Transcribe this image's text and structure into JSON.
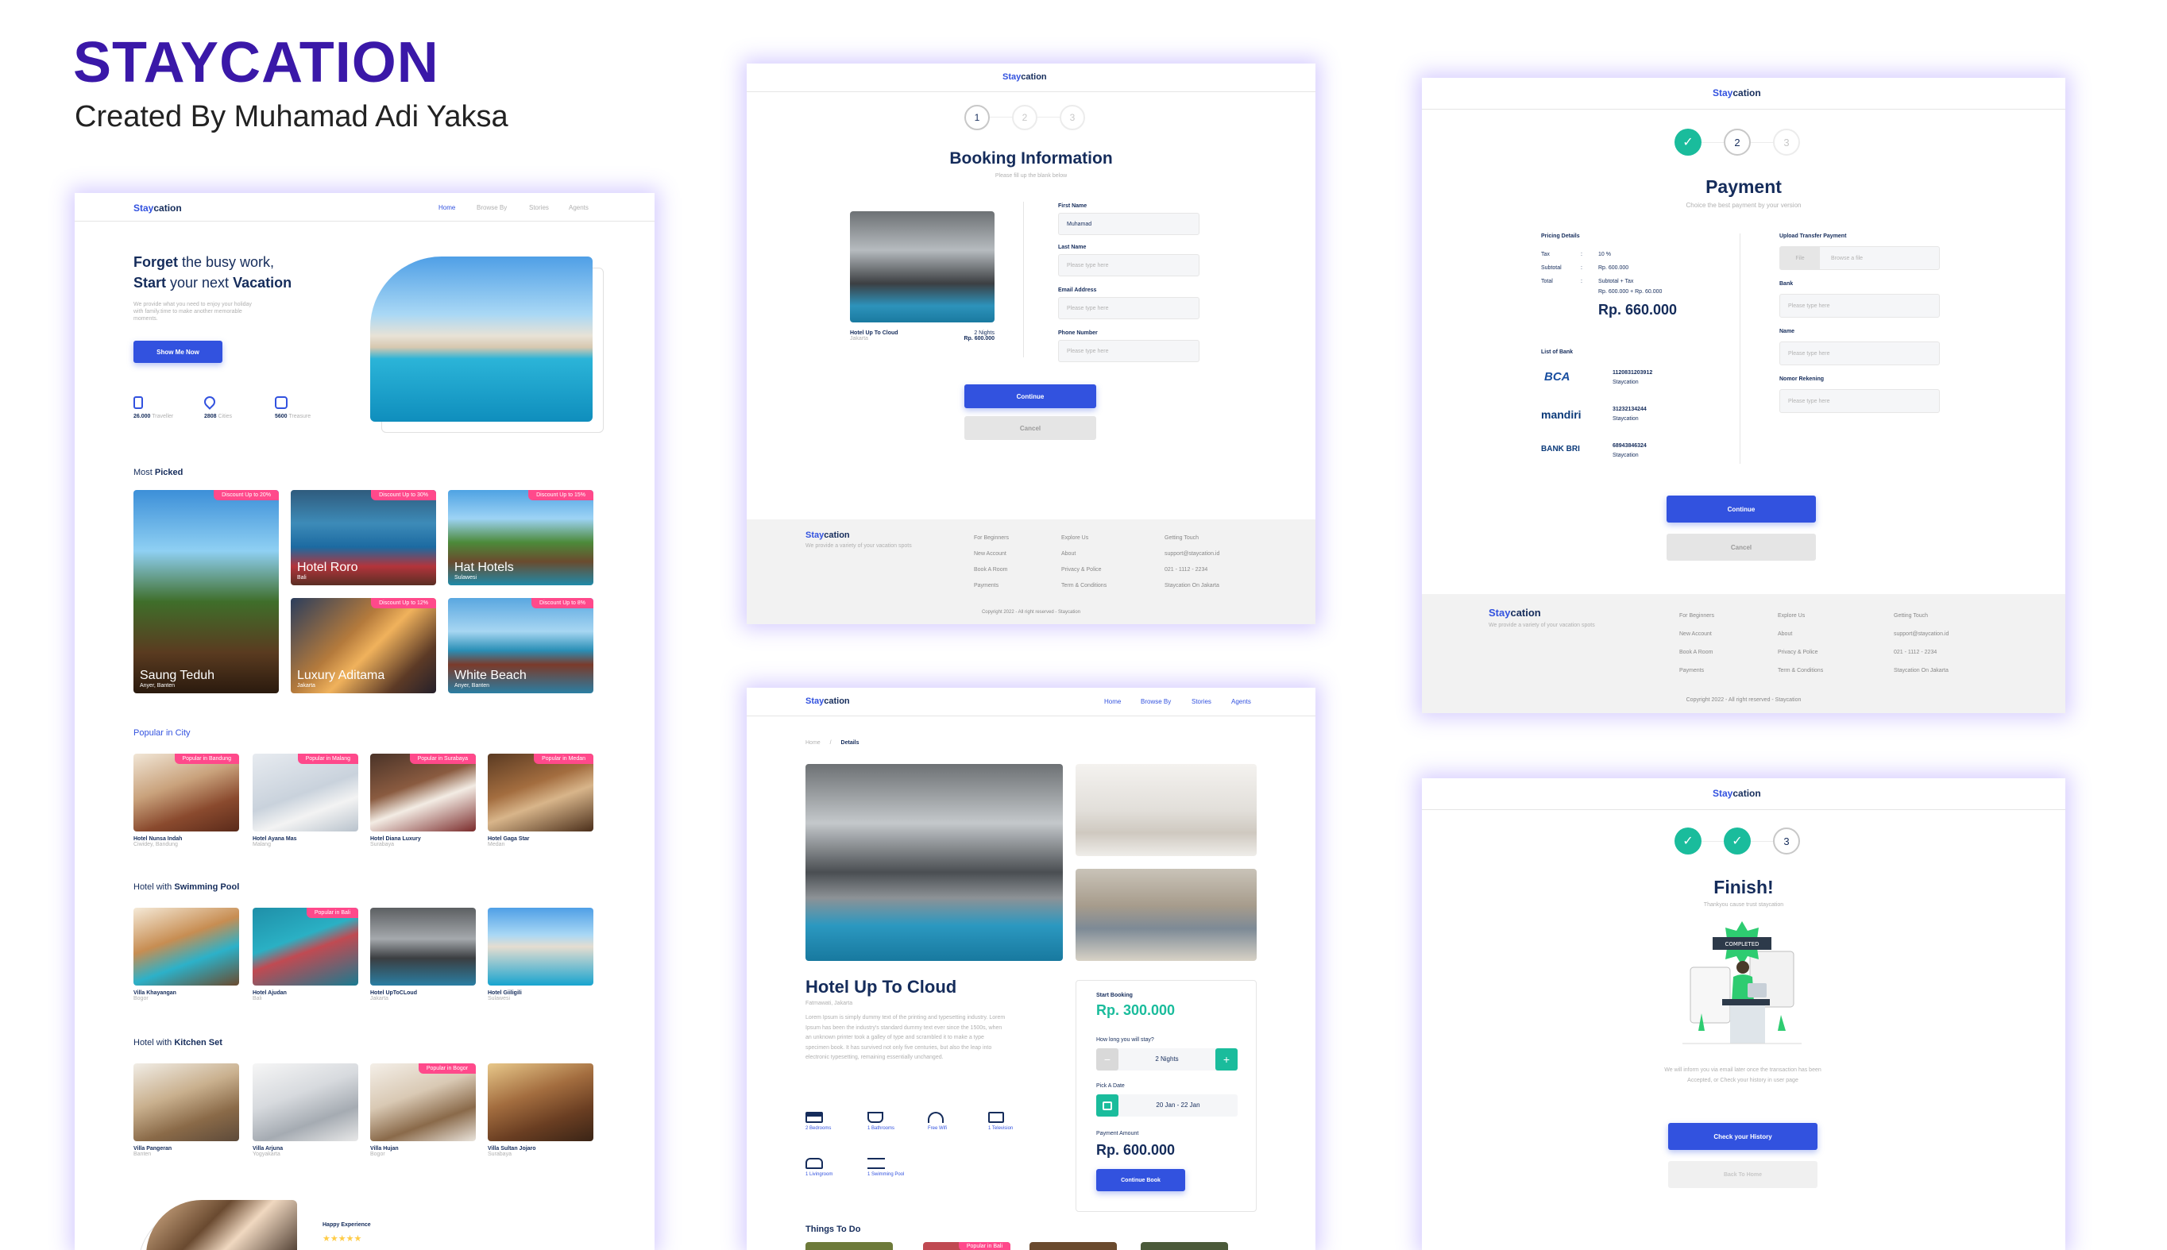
{
  "header": {
    "title": "STAYCATION",
    "subtitle": "Created By Muhamad Adi Yaksa"
  },
  "brand": {
    "stay": "Stay",
    "cation": "cation"
  },
  "nav": {
    "home": "Home",
    "browse": "Browse By",
    "stories": "Stories",
    "agents": "Agents"
  },
  "landing": {
    "hero_l1_a": "Forget ",
    "hero_l1_b": "the busy work,",
    "hero_l2_a": "Start ",
    "hero_l2_b": "your next ",
    "hero_l2_c": "Vacation",
    "hero_desc": "We provide what you need to enjoy your holiday with family.time to make another memorable moments.",
    "cta": "Show Me Now",
    "stats": [
      {
        "num": "26.000",
        "label": "Traveller",
        "icon": "traveler-icon"
      },
      {
        "num": "2808",
        "label": "Cities",
        "icon": "cities-icon"
      },
      {
        "num": "5600",
        "label": "Treasure",
        "icon": "treasure-icon"
      }
    ],
    "most_picked_a": "Most ",
    "most_picked_b": "Picked",
    "most_picked": [
      {
        "name": "Saung Teduh",
        "loc": "Anyer, Banten",
        "badge": "Discount Up to 20%"
      },
      {
        "name": "Hotel Roro",
        "loc": "Bali",
        "badge": "Discount Up to 30%"
      },
      {
        "name": "Hat Hotels",
        "loc": "Sulawesi",
        "badge": "Discount Up to 15%"
      },
      {
        "name": "Luxury Aditama",
        "loc": "Jakarta",
        "badge": "Discount Up to 12%"
      },
      {
        "name": "White Beach",
        "loc": "Anyer, Banten",
        "badge": "Discount Up to 8%"
      }
    ],
    "sections": [
      {
        "title_a": "Popular in City",
        "title_b": "",
        "items": [
          {
            "name": "Hotel Nunsa Indah",
            "loc": "Ciwidey, Bandung",
            "badge": "Popular in Bandung"
          },
          {
            "name": "Hotel Ayana Mas",
            "loc": "Malang",
            "badge": "Popular in Malang"
          },
          {
            "name": "Hotel Diana Luxury",
            "loc": "Surabaya",
            "badge": "Popular in Surabaya"
          },
          {
            "name": "Hotel Gaga Star",
            "loc": "Medan",
            "badge": "Popular in Medan"
          }
        ]
      },
      {
        "title_a": "Hotel with ",
        "title_b": "Swimming Pool",
        "items": [
          {
            "name": "Villa Khayangan",
            "loc": "Bogor",
            "badge": ""
          },
          {
            "name": "Hotel Ajudan",
            "loc": "Bali",
            "badge": "Popular in Bali"
          },
          {
            "name": "Hotel UpToCLoud",
            "loc": "Jakarta",
            "badge": ""
          },
          {
            "name": "Hotel Giiligili",
            "loc": "Sulawesi",
            "badge": ""
          }
        ]
      },
      {
        "title_a": "Hotel with ",
        "title_b": "Kitchen Set",
        "items": [
          {
            "name": "Villa Pangeran",
            "loc": "Banten",
            "badge": ""
          },
          {
            "name": "Villa Arjuna",
            "loc": "Yogyakarta",
            "badge": ""
          },
          {
            "name": "Villa Hujan",
            "loc": "Bogor",
            "badge": "Popular in Bogor"
          },
          {
            "name": "Villa Sultan Jojaro",
            "loc": "Surabaya",
            "badge": ""
          }
        ]
      }
    ],
    "happy": "Happy Experience",
    "stars": "★★★★★"
  },
  "booking": {
    "title": "Booking Information",
    "subtitle": "Please fill up the blank below",
    "steps": [
      "1",
      "2",
      "3"
    ],
    "hotel": "Hotel Up To Cloud",
    "city": "Jakarta",
    "nights": "2 Nights",
    "price": "Rp. 600.000",
    "fields": [
      {
        "label": "First Name",
        "value": "Muhamad"
      },
      {
        "label": "Last Name",
        "value": "Please type here"
      },
      {
        "label": "Email Address",
        "value": "Please type here"
      },
      {
        "label": "Phone Number",
        "value": "Please type here"
      }
    ],
    "continue": "Continue",
    "cancel": "Cancel"
  },
  "footer": {
    "desc": "We provide a variety of your vacation spots",
    "col1": [
      "For Beginners",
      "New Account",
      "Book A Room",
      "Payments"
    ],
    "col2": [
      "Explore Us",
      "About",
      "Privacy & Police",
      "Term & Conditions"
    ],
    "col3": [
      "Getting Touch",
      "support@staycation.id",
      "021 - 1112 - 2234",
      "Staycation On Jakarta"
    ],
    "copyright": "Copyright 2022 - All right reserved - Staycation"
  },
  "payment": {
    "title": "Payment",
    "subtitle": "Choice the best payment by your version",
    "check": "✓",
    "step2": "2",
    "step3": "3",
    "pricing_title": "Pricing Details",
    "rows": [
      {
        "k": "Tax",
        "v": "10 %"
      },
      {
        "k": "Subtotal",
        "v": "Rp. 600.000"
      },
      {
        "k": "Total",
        "v": "Subtotal + Tax"
      }
    ],
    "calc": "Rp. 600.000  + Rp. 60.000",
    "total": "Rp. 660.000",
    "list_bank": "List of Bank",
    "banks": [
      {
        "logo": "BCA",
        "num": "1120831203912",
        "name": "Staycation"
      },
      {
        "logo": "mandiri",
        "num": "31232134244",
        "name": "Staycation"
      },
      {
        "logo": "BANK BRI",
        "num": "68943846324",
        "name": "Staycation"
      }
    ],
    "upload_label": "Upload Transfer Payment",
    "file_btn": "File",
    "file_ph": "Browse a file",
    "fields": [
      {
        "label": "Bank",
        "ph": "Please type here"
      },
      {
        "label": "Name",
        "ph": "Please type here"
      },
      {
        "label": "Nomor Rekening",
        "ph": "Please type here"
      }
    ],
    "continue": "Continue",
    "cancel": "Cancel"
  },
  "details": {
    "crumb_home": "Home",
    "crumb_sep": "/",
    "crumb_cur": "Details",
    "title": "Hotel Up To Cloud",
    "loc": "Fatmawati, Jakarta",
    "desc": "Lorem Ipsum is simply dummy text of the printing and typesetting industry. Lorem Ipsum has been the industry's standard dummy text ever since the 1500s, when an unknown printer took a galley of type and scrambled it to make a type specimen book. It has survived not only five centuries, but also the leap into electronic typesetting, remaining essentially unchanged.",
    "features": [
      {
        "t": "2 Bedrooms",
        "i": "bed-icon"
      },
      {
        "t": "1 Bathrooms",
        "i": "bath-icon"
      },
      {
        "t": "Free Wifi",
        "i": "wifi-icon"
      },
      {
        "t": "1 Television",
        "i": "tv-icon"
      },
      {
        "t": "1 Livingroom",
        "i": "sofa-icon"
      },
      {
        "t": "1 Swimming Pool",
        "i": "pool-icon"
      }
    ],
    "start": "Start Booking",
    "price": "Rp. 300.000",
    "how_long": "How long you will stay?",
    "nights": "2 Nights",
    "minus": "−",
    "plus": "+",
    "pick_date": "Pick A Date",
    "dates": "20 Jan - 22 Jan",
    "pay_amount": "Payment Amount",
    "amount": "Rp. 600.000",
    "continue": "Continue Book",
    "things": "Things To Do",
    "things_badge": "Popular in Bali"
  },
  "finish": {
    "title": "Finish!",
    "subtitle": "Thankyou cause trust staycation",
    "check": "✓",
    "step3": "3",
    "completed": "COMPLETED",
    "msg": "We will inform you via email later once the transaction has been Accepted, or Check your history in user page",
    "history": "Check your History",
    "home": "Back To Home"
  }
}
